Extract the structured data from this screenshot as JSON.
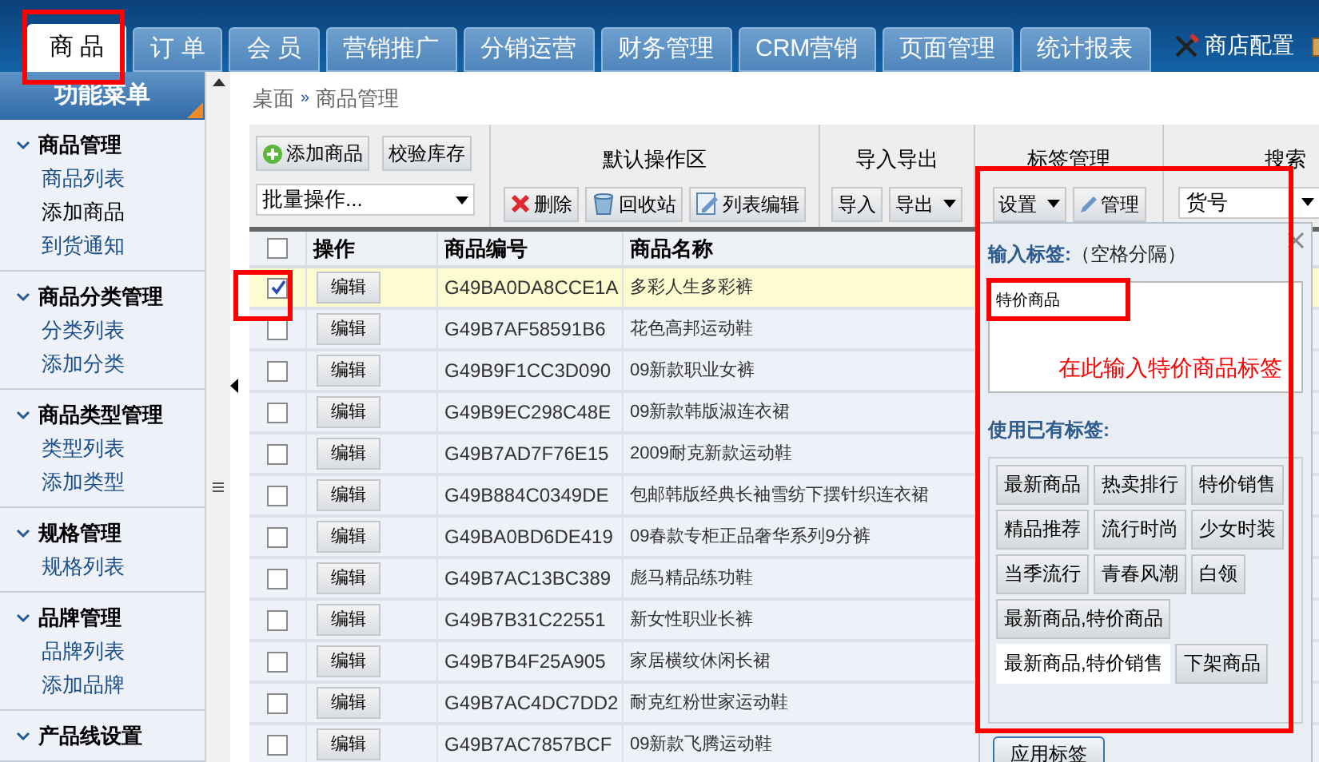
{
  "top_nav": {
    "tabs": [
      {
        "label": "商 品",
        "selected": true
      },
      {
        "label": "订 单",
        "selected": false
      },
      {
        "label": "会 员",
        "selected": false
      },
      {
        "label": "营销推广",
        "selected": false
      },
      {
        "label": "分销运营",
        "selected": false
      },
      {
        "label": "财务管理",
        "selected": false
      },
      {
        "label": "CRM营销",
        "selected": false
      },
      {
        "label": "页面管理",
        "selected": false
      },
      {
        "label": "统计报表",
        "selected": false
      }
    ],
    "shop_settings": "商店配置"
  },
  "sidebar": {
    "title": "功能菜单",
    "groups": [
      {
        "label": "商品管理",
        "expanded": true,
        "items": [
          {
            "label": "商品列表",
            "selected": false
          },
          {
            "label": "添加商品",
            "selected": true
          },
          {
            "label": "到货通知",
            "selected": false
          }
        ]
      },
      {
        "label": "商品分类管理",
        "expanded": true,
        "items": [
          {
            "label": "分类列表",
            "selected": false
          },
          {
            "label": "添加分类",
            "selected": false
          }
        ]
      },
      {
        "label": "商品类型管理",
        "expanded": true,
        "items": [
          {
            "label": "类型列表",
            "selected": false
          },
          {
            "label": "添加类型",
            "selected": false
          }
        ]
      },
      {
        "label": "规格管理",
        "expanded": true,
        "items": [
          {
            "label": "规格列表",
            "selected": false
          }
        ]
      },
      {
        "label": "品牌管理",
        "expanded": true,
        "items": [
          {
            "label": "品牌列表",
            "selected": false
          },
          {
            "label": "添加品牌",
            "selected": false
          }
        ]
      },
      {
        "label": "产品线设置",
        "expanded": true
      }
    ]
  },
  "breadcrumb": [
    "桌面",
    "»",
    "商品管理"
  ],
  "toolbar": {
    "add_button": "添加商品",
    "check_stock_button": "校验库存",
    "batch_select": "批量操作...",
    "default_area": {
      "title": "默认操作区",
      "buttons": [
        {
          "kind": "delete",
          "label": "删除"
        },
        {
          "kind": "recycle",
          "label": "回收站"
        },
        {
          "kind": "edit",
          "label": "列表编辑"
        }
      ]
    },
    "import_export": {
      "title": "导入导出",
      "import": "导入",
      "export": "导出"
    },
    "tag_manage": {
      "title": "标签管理",
      "settings": "设置",
      "manage": "管理"
    },
    "search": {
      "title": "搜索",
      "field": "货号"
    }
  },
  "table": {
    "all_checked": false,
    "columns": [
      "操作",
      "商品编号",
      "商品名称"
    ],
    "rows": [
      {
        "checked": true,
        "action": "编辑",
        "code": "G49BA0DA8CCE1A",
        "name": "多彩人生多彩裤"
      },
      {
        "checked": false,
        "action": "编辑",
        "code": "G49B7AF58591B6",
        "name": "花色高邦运动鞋"
      },
      {
        "checked": false,
        "action": "编辑",
        "code": "G49B9F1CC3D090",
        "name": "09新款职业女裤"
      },
      {
        "checked": false,
        "action": "编辑",
        "code": "G49B9EC298C48E",
        "name": "09新款韩版淑连衣裙"
      },
      {
        "checked": false,
        "action": "编辑",
        "code": "G49B7AD7F76E15",
        "name": "2009耐克新款运动鞋"
      },
      {
        "checked": false,
        "action": "编辑",
        "code": "G49B884C0349DE",
        "name": "包邮韩版经典长袖雪纺下摆针织连衣裙"
      },
      {
        "checked": false,
        "action": "编辑",
        "code": "G49BA0BD6DE419",
        "name": "09春款专柜正品奢华系列9分裤"
      },
      {
        "checked": false,
        "action": "编辑",
        "code": "G49B7AC13BC389",
        "name": "彪马精品练功鞋"
      },
      {
        "checked": false,
        "action": "编辑",
        "code": "G49B7B31C22551",
        "name": "新女性职业长裤"
      },
      {
        "checked": false,
        "action": "编辑",
        "code": "G49B7B4F25A905",
        "name": "家居横纹休闲长裙"
      },
      {
        "checked": false,
        "action": "编辑",
        "code": "G49B7AC4DC7DD2",
        "name": "耐克红粉世家运动鞋"
      },
      {
        "checked": false,
        "action": "编辑",
        "code": "G49B7AC7857BCF",
        "name": "09新款飞腾运动鞋"
      }
    ]
  },
  "tag_popup": {
    "input_label": "输入标签:",
    "input_hint": "（空格分隔）",
    "input_value": "特价商品",
    "annotation": "在此输入特价商品标签",
    "existing_label": "使用已有标签:",
    "tags": [
      {
        "label": "最新商品",
        "selected": false
      },
      {
        "label": "热卖排行",
        "selected": false
      },
      {
        "label": "特价销售",
        "selected": false
      },
      {
        "label": "精品推荐",
        "selected": false
      },
      {
        "label": "流行时尚",
        "selected": false
      },
      {
        "label": "少女时装",
        "selected": false
      },
      {
        "label": "当季流行",
        "selected": false
      },
      {
        "label": "青春风潮",
        "selected": false
      },
      {
        "label": "白领",
        "selected": false
      },
      {
        "label": "最新商品,特价商品",
        "selected": false
      },
      {
        "label": "最新商品,特价销售",
        "selected": true
      },
      {
        "label": "下架商品",
        "selected": false
      }
    ],
    "apply_button": "应用标签"
  }
}
